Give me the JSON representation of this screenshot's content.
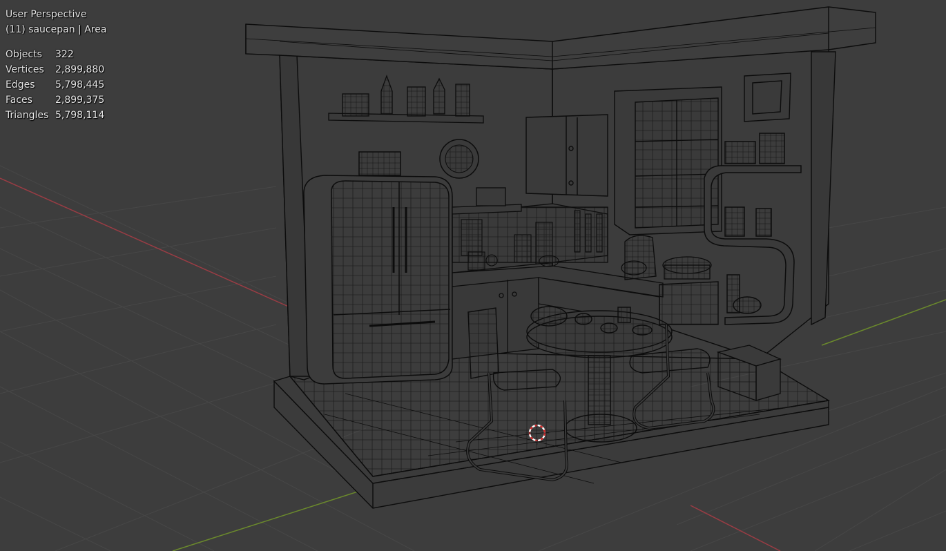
{
  "viewport": {
    "view_name": "User Perspective",
    "context_line": "(11) saucepan | Area",
    "stats": [
      {
        "label": "Objects",
        "value": "322"
      },
      {
        "label": "Vertices",
        "value": "2,899,880"
      },
      {
        "label": "Edges",
        "value": "5,798,445"
      },
      {
        "label": "Faces",
        "value": "2,899,375"
      },
      {
        "label": "Triangles",
        "value": "5,798,114"
      }
    ]
  },
  "colors": {
    "background": "#3d3d3d",
    "grid": "#474747",
    "wire": "#0c0c0c",
    "x_axis": "#9b3c44",
    "y_axis": "#6b8a2c",
    "cursor_red": "#d22b2b"
  },
  "scene_objects": [
    "fridge",
    "wall-shelf",
    "wall-clock",
    "upper-cabinet",
    "window",
    "picture-frame",
    "counter",
    "stand-mixer",
    "saucepan",
    "round-table",
    "chair-front",
    "chair-back",
    "curved-shelf",
    "bench",
    "floor-base"
  ]
}
